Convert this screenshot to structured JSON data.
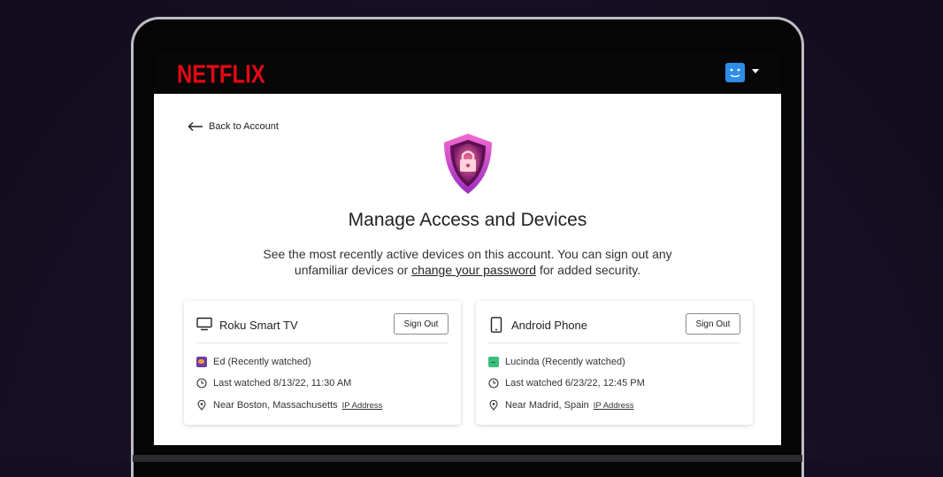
{
  "header": {
    "logo_text": "NETFLIX",
    "avatar_icon": "smiley-profile-icon",
    "menu_icon": "caret-down-icon"
  },
  "nav": {
    "back_label": "Back to Account",
    "back_icon": "arrow-left-icon"
  },
  "page": {
    "title": "Manage Access and Devices",
    "subtitle_before": "See the most recently active devices on this account. You can sign out any unfamiliar devices or ",
    "subtitle_link": "change your password",
    "subtitle_after": " for added security.",
    "hero_icon": "lock-shield-icon"
  },
  "devices": [
    {
      "icon": "tv-icon",
      "name": "Roku Smart TV",
      "signout_label": "Sign Out",
      "profile": "Ed (Recently watched)",
      "last_watched": "Last watched 8/13/22, 11:30 AM",
      "location": "Near Boston, Massachusetts",
      "ip_label": "IP Address"
    },
    {
      "icon": "phone-icon",
      "name": "Android Phone",
      "signout_label": "Sign Out",
      "profile": "Lucinda (Recently watched)",
      "last_watched": "Last watched 6/23/22, 12:45 PM",
      "location": "Near Madrid, Spain",
      "ip_label": "IP Address"
    }
  ],
  "colors": {
    "brand_red": "#e50914",
    "avatar_blue": "#2e8ee8",
    "shield_pink": "#e040c8"
  }
}
